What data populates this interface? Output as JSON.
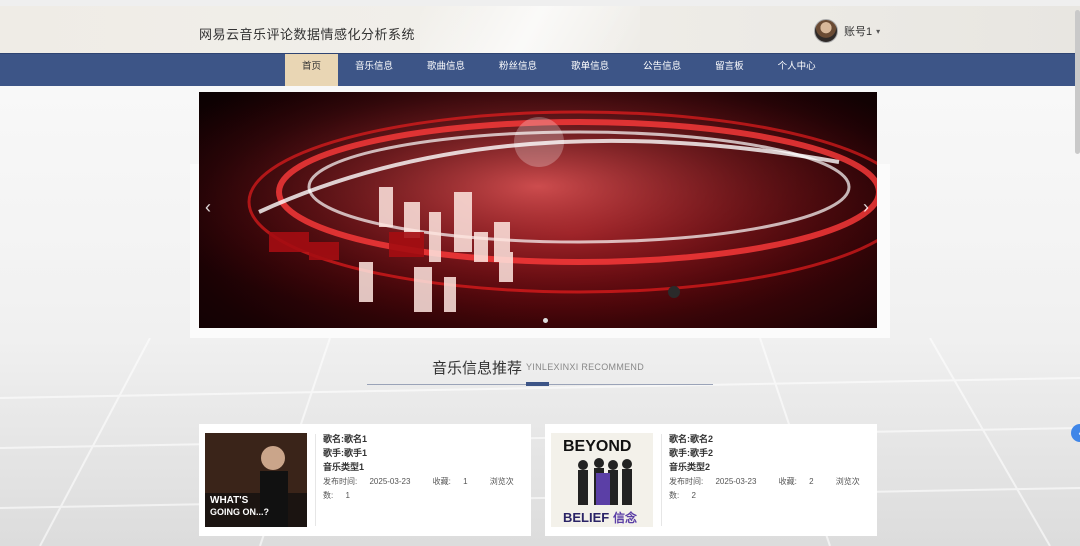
{
  "header": {
    "site_title": "网易云音乐评论数据情感化分析系统",
    "account_name": "账号1",
    "caret": "▾"
  },
  "nav": {
    "items": [
      "首页",
      "音乐信息",
      "歌曲信息",
      "粉丝信息",
      "歌单信息",
      "公告信息",
      "留言板",
      "个人中心"
    ],
    "active_index": 0
  },
  "banner": {
    "prev": "‹",
    "next": "›"
  },
  "section": {
    "title": "音乐信息推荐",
    "subtitle": "YINLEXINXI RECOMMEND"
  },
  "cards": [
    {
      "song": "歌名:歌名1",
      "singer": "歌手:歌手1",
      "type": "音乐类型1",
      "date_label": "发布时间:",
      "date": "2025-03-23",
      "fav_label": "收藏:",
      "fav": "1",
      "views_label": "浏览次数:",
      "views": "1",
      "cover_text": "WHAT'S GOING ON...?"
    },
    {
      "song": "歌名:歌名2",
      "singer": "歌手:歌手2",
      "type": "音乐类型2",
      "date_label": "发布时间:",
      "date": "2025-03-23",
      "fav_label": "收藏:",
      "fav": "2",
      "views_label": "浏览次数:",
      "views": "2",
      "cover_text_top": "BEYOND",
      "cover_text_bottom": "BELIEF信念"
    }
  ],
  "colors": {
    "nav_bg": "#3d5587",
    "nav_active": "#e9d6b4",
    "side_button": "#3f86e8"
  }
}
